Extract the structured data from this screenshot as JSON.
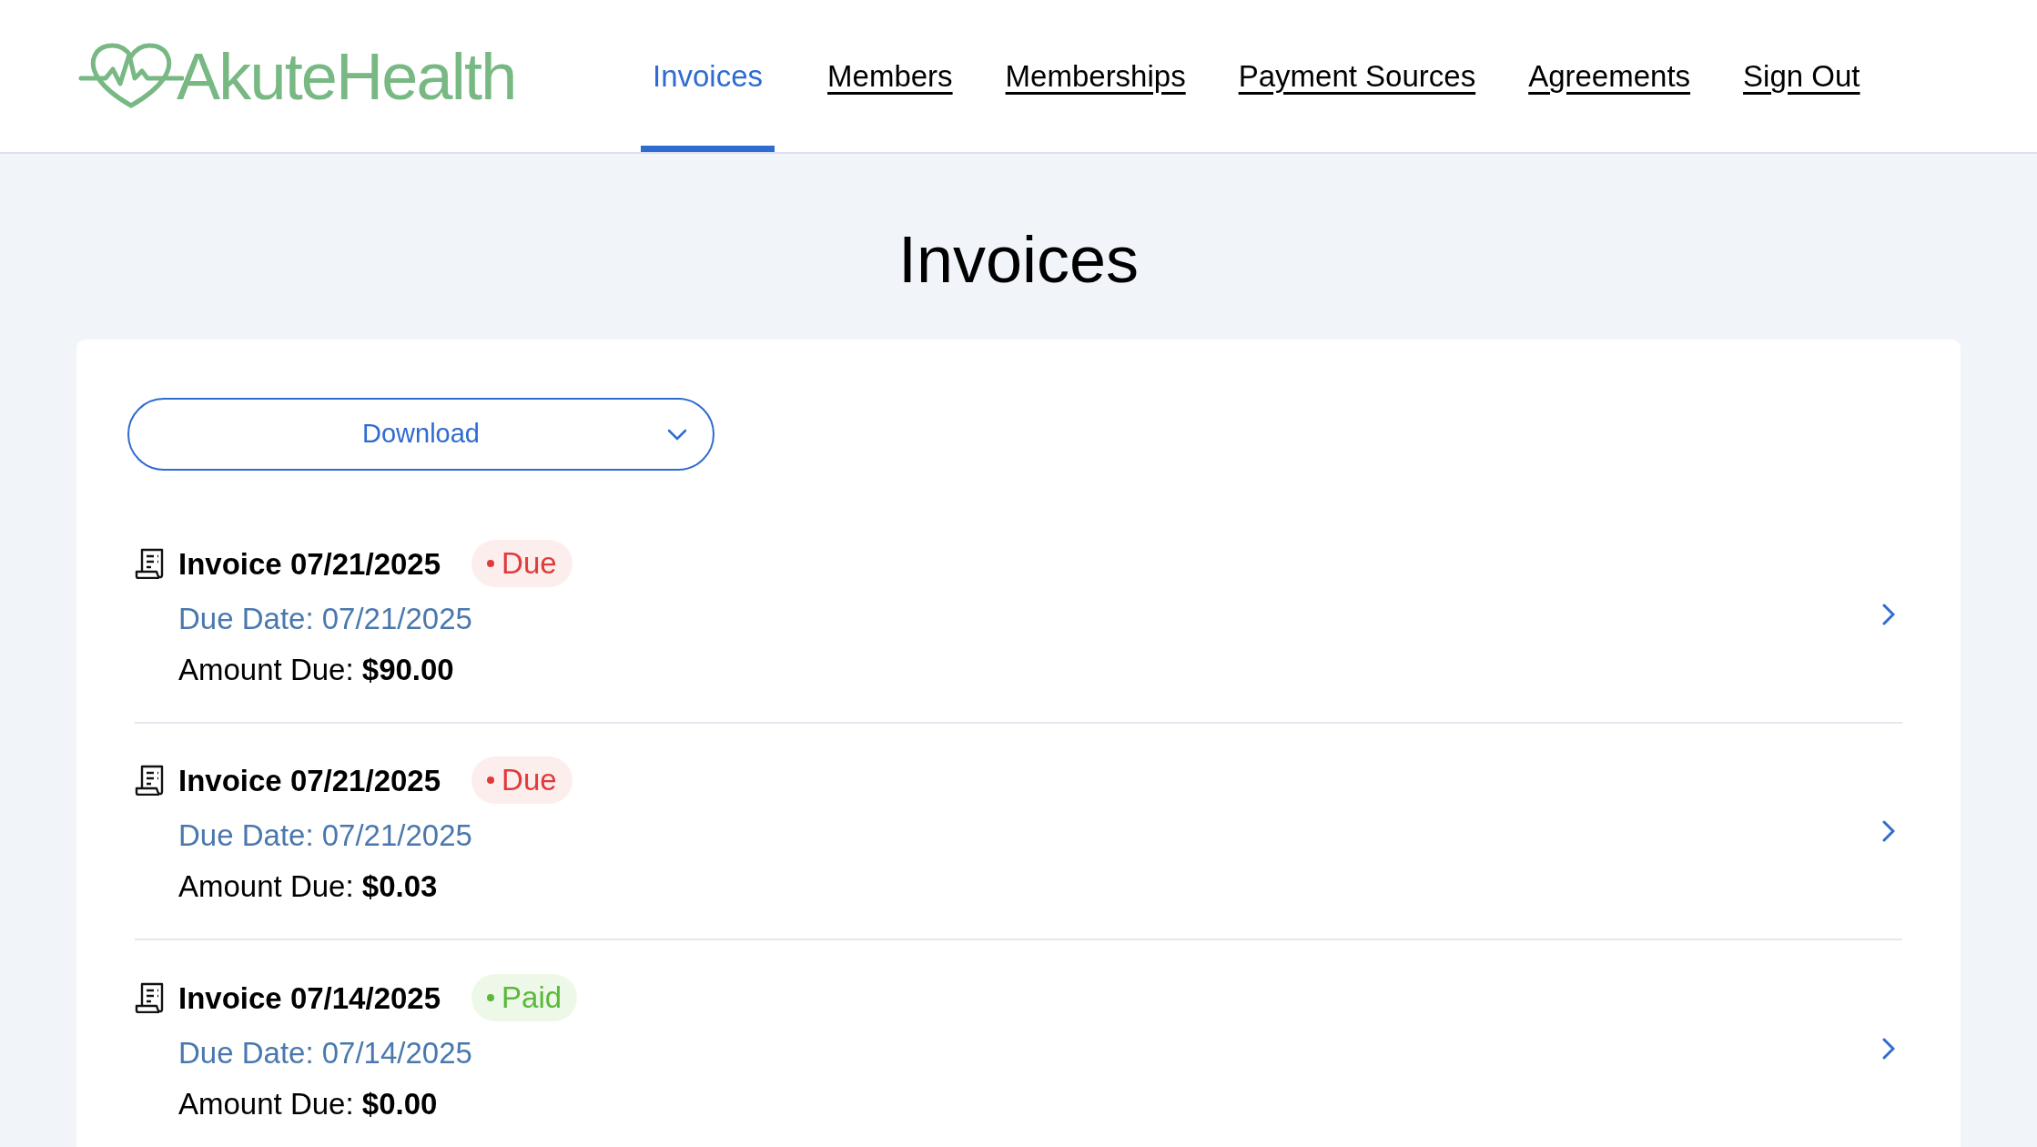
{
  "header": {
    "logo_text": "AkuteHealth",
    "nav": [
      {
        "label": "Invoices",
        "selected": true
      },
      {
        "label": "Members",
        "selected": false
      },
      {
        "label": "Memberships",
        "selected": false
      },
      {
        "label": "Payment Sources",
        "selected": false
      },
      {
        "label": "Agreements",
        "selected": false
      },
      {
        "label": "Sign Out",
        "selected": false
      }
    ]
  },
  "page_title": "Invoices",
  "download_button": {
    "label": "Download"
  },
  "invoices": [
    {
      "title": "Invoice 07/21/2025",
      "kind": "due",
      "badge": "Due",
      "due_date": "Due Date: 07/21/2025",
      "amount_label": "Amount Due:",
      "amount": "$90.00"
    },
    {
      "title": "Invoice 07/21/2025",
      "kind": "due",
      "badge": "Due",
      "due_date": "Due Date: 07/21/2025",
      "amount_label": "Amount Due:",
      "amount": "$0.03"
    },
    {
      "title": "Invoice 07/14/2025",
      "kind": "paid",
      "badge": "Paid",
      "due_date": "Due Date: 07/14/2025",
      "amount_label": "Amount Due:",
      "amount": "$0.00"
    }
  ]
}
